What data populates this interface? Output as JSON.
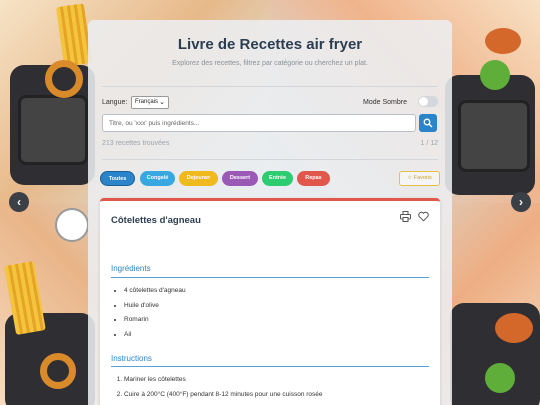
{
  "app": {
    "title": "Livre de Recettes air fryer",
    "subtitle": "Explorez des recettes, filtrez par catégorie ou cherchez un plat."
  },
  "settings": {
    "language_label": "Langue:",
    "language_value": "Français",
    "dark_mode_label": "Mode Sombre",
    "dark_mode_on": false
  },
  "search": {
    "placeholder": "Titre, ou 'xxx' puis ingrédients..."
  },
  "results": {
    "count_text": "213 recettes trouvées",
    "pages_text": "1 / 12"
  },
  "categories": [
    {
      "label": "Toutes",
      "color": "#2b84c9"
    },
    {
      "label": "Congelé",
      "color": "#39a8e0"
    },
    {
      "label": "Dejeuner",
      "color": "#f0b91e"
    },
    {
      "label": "Dessert",
      "color": "#9b59b6"
    },
    {
      "label": "Entrée",
      "color": "#2ecc71"
    },
    {
      "label": "Repas",
      "color": "#e2574c"
    }
  ],
  "favorites_label": "☆ Favoris",
  "recipe": {
    "title": "Côtelettes d'agneau",
    "ingredients_heading": "Ingrédients",
    "ingredients": [
      "4 côtelettes d'agneau",
      "Huile d'olive",
      "Romarin",
      "Ail"
    ],
    "instructions_heading": "Instructions",
    "steps": [
      "Mariner les côtelettes",
      "Cuire à 200°C (400°F) pendant 8-12 minutes pour une cuisson rosée"
    ]
  },
  "icons": {
    "carousel_prev": "chevron-left-icon",
    "carousel_next": "chevron-right-icon",
    "search": "search-icon",
    "print": "print-icon",
    "favorite": "heart-icon"
  }
}
